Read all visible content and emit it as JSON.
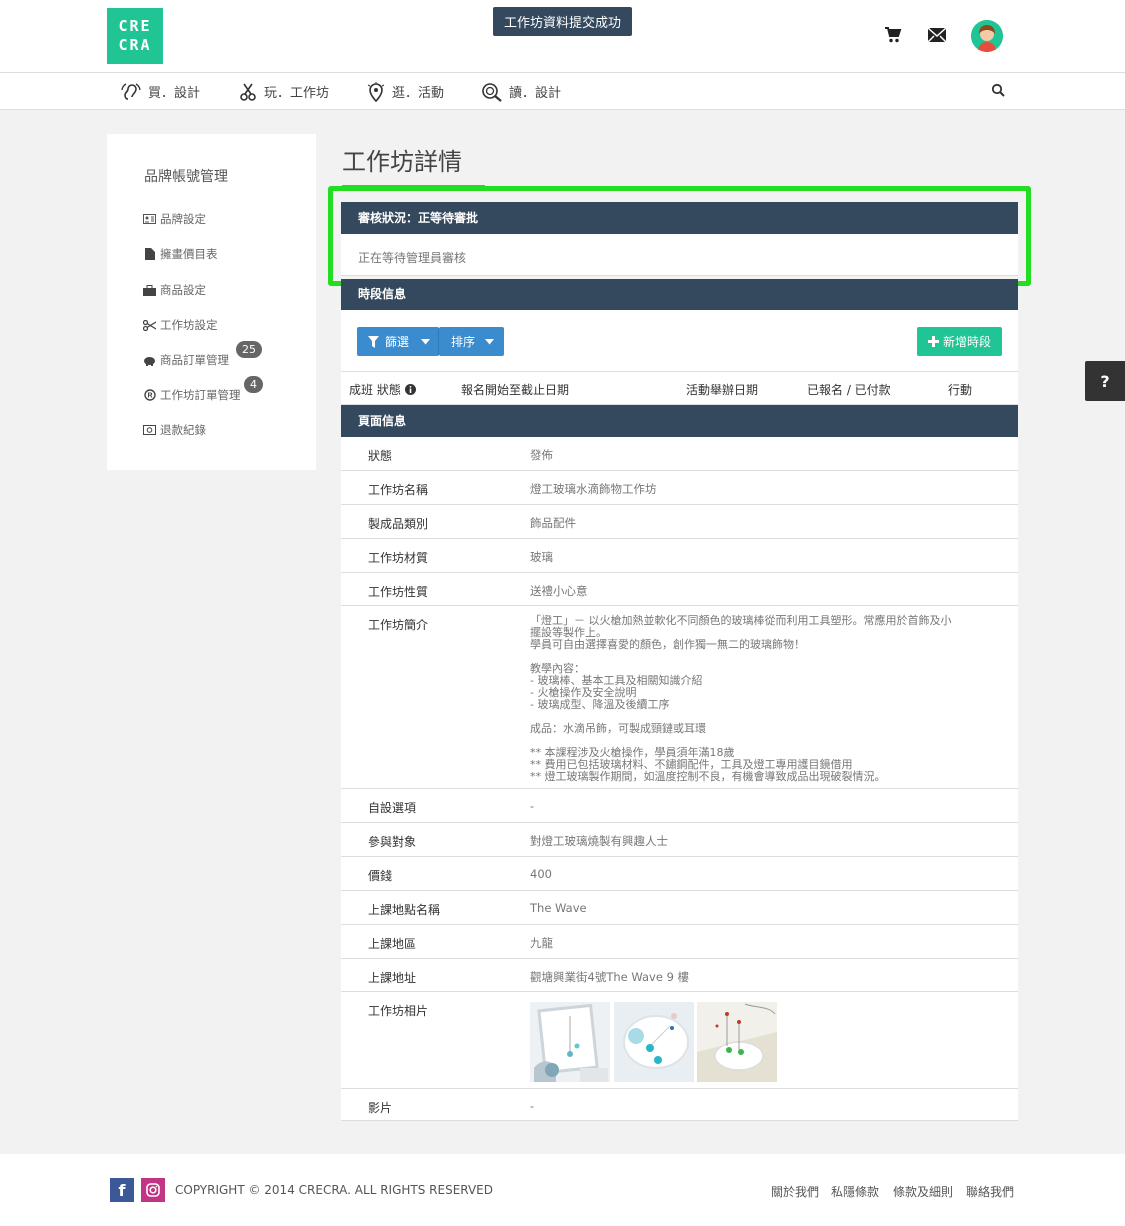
{
  "header": {
    "logo_top": "CRE",
    "logo_bottom": "CRA",
    "toast": "工作坊資料提交成功",
    "icons": [
      "cart-icon",
      "mail-icon",
      "avatar"
    ]
  },
  "nav": {
    "items": [
      {
        "label": "買．設計",
        "icon": "ear-icon"
      },
      {
        "label": "玩．工作坊",
        "icon": "scissors-icon"
      },
      {
        "label": "逛．活動",
        "icon": "location-icon"
      },
      {
        "label": "讀．設計",
        "icon": "magnifier-icon"
      }
    ],
    "search_icon": "search-icon"
  },
  "sidebar": {
    "title": "品牌帳號管理",
    "items": [
      {
        "label": "品牌設定",
        "icon": "id-card-icon"
      },
      {
        "label": "擁畫價目表",
        "icon": "document-icon"
      },
      {
        "label": "商品設定",
        "icon": "briefcase-icon"
      },
      {
        "label": "工作坊設定",
        "icon": "scissors-icon"
      },
      {
        "label": "商品訂單管理",
        "icon": "piggy-bank-icon",
        "badge": "25"
      },
      {
        "label": "工作坊訂單管理",
        "icon": "registered-icon",
        "badge": "4"
      },
      {
        "label": "退款紀錄",
        "icon": "money-icon"
      }
    ]
  },
  "main": {
    "title": "工作坊詳情",
    "review": {
      "header": "審核狀況：正等待審批",
      "body": "正在等待管理員審核"
    },
    "sessions": {
      "header": "時段信息",
      "filter_label": "篩選",
      "sort_label": "排序",
      "add_label": "新增時段",
      "columns": [
        "成班 狀態",
        "報名開始至截止日期",
        "活動舉辦日期",
        "已報名 / 已付款",
        "行動"
      ]
    },
    "page_info": {
      "header": "頁面信息",
      "rows": [
        {
          "key": "狀態",
          "value": "發佈"
        },
        {
          "key": "工作坊名稱",
          "value": "燈工玻璃水滴飾物工作坊"
        },
        {
          "key": "製成品類別",
          "value": "飾品配件"
        },
        {
          "key": "工作坊材質",
          "value": "玻璃"
        },
        {
          "key": "工作坊性質",
          "value": "送禮小心意"
        },
        {
          "key": "工作坊簡介",
          "value": ""
        },
        {
          "key": "自設選項",
          "value": "-"
        },
        {
          "key": "參與對象",
          "value": "對燈工玻璃燒製有興趣人士"
        },
        {
          "key": "價錢",
          "value": "400"
        },
        {
          "key": "上課地點名稱",
          "value": "The Wave"
        },
        {
          "key": "上課地區",
          "value": "九龍"
        },
        {
          "key": "上課地址",
          "value": "觀塘興業街4號The Wave 9 樓"
        },
        {
          "key": "工作坊相片",
          "value": ""
        },
        {
          "key": "影片",
          "value": "-"
        }
      ],
      "intro_lines": [
        "「燈工」－ 以火槍加熱並軟化不同顏色的玻璃棒從而利用工具塑形。常應用於首飾及小",
        "擺設等製作上。",
        "學員可自由選擇喜愛的顏色，創作獨一無二的玻璃飾物！",
        "",
        "教學內容：",
        " - 玻璃棒、基本工具及相關知識介紹",
        " - 火槍操作及安全說明",
        " - 玻璃成型、降溫及後續工序",
        "",
        "成品：水滴吊飾，可製成頸鏈或耳環",
        "",
        "** 本課程涉及火槍操作，學員須年滿18歲",
        "** 費用已包括玻璃材料、不鏽鋼配件，工具及燈工專用護目鏡借用",
        "** 燈工玻璃製作期間，如溫度控制不良，有機會導致成品出現破裂情況。"
      ]
    }
  },
  "help": "?",
  "footer": {
    "copyright": "COPYRIGHT © 2014 CRECRA. ALL RIGHTS RESERVED",
    "links": [
      "關於我們",
      "私隱條款",
      "條款及細則",
      "聯絡我們"
    ]
  },
  "colors": {
    "accent": "#21c495",
    "panel_header": "#34495e",
    "filter_button": "#3a8ccf",
    "highlight": "#22dd22"
  }
}
